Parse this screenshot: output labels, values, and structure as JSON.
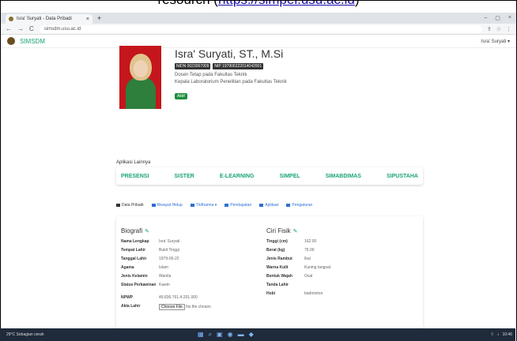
{
  "caption": {
    "before": "resourch (",
    "link": "https://simpel.usu.ac.id",
    "after": ")"
  },
  "browser": {
    "tab_title": "Isra' Suryati - Data Pribadi",
    "tab_close": "×",
    "new_tab": "+",
    "url": "simsdm.usu.ac.id",
    "controls": {
      "minimize": "–",
      "maximize": "▢",
      "close": "×"
    }
  },
  "app": {
    "brand": "SIMSDM",
    "user": "Isra' Suryati ▾"
  },
  "profile": {
    "name": "Isra' Suryati, ST., M.Si",
    "nidn": "NIDN 0023067909",
    "nip": "NIP 197906222014042001",
    "role": "Dosen Tetap pada Fakultas Teknik",
    "position": "Kepala Laboratorium Penelitian pada Fakultas Teknik",
    "status": "Aktif"
  },
  "apps": {
    "title": "Aplikasi Lainnya",
    "items": [
      "PRESENSI",
      "SISTER",
      "E-LEARNING",
      "SIMPEL",
      "SIMABDIMAS",
      "SIPUSTAHA"
    ]
  },
  "tabs": [
    "Data Pribadi",
    "Riwayat Hidup",
    "Tridharma ▾",
    "Pendapatan",
    "Aplikasi",
    "Pengaturan"
  ],
  "biografi": {
    "title": "Biografi",
    "rows": [
      {
        "k": "Nama Lengkap",
        "v": "Isra' Suryati"
      },
      {
        "k": "Tempat Lahir",
        "v": "Bukit Tinggi"
      },
      {
        "k": "Tanggal Lahir",
        "v": "1979-06-22"
      },
      {
        "k": "Agama",
        "v": "Islam"
      },
      {
        "k": "Jenis Kelamin",
        "v": "Wanita"
      },
      {
        "k": "Status Perkawinan",
        "v": "Kawin"
      },
      {
        "k": "NPWP",
        "v": "49.836.761.4-201.000"
      },
      {
        "k": "Akta Lahir",
        "v": "No file chosen"
      }
    ],
    "file_button": "Choose File"
  },
  "ciri_fisik": {
    "title": "Ciri Fisik",
    "rows": [
      {
        "k": "Tinggi (cm)",
        "v": "162.00"
      },
      {
        "k": "Berat (kg)",
        "v": "75.00"
      },
      {
        "k": "Jenis Rambut",
        "v": "Ikal"
      },
      {
        "k": "Warna Kulit",
        "v": "Kuning langsat"
      },
      {
        "k": "Bentuk Wajah",
        "v": "Oval"
      },
      {
        "k": "Tanda Lahir",
        "v": ""
      },
      {
        "k": "Hobi",
        "v": "badminton"
      }
    ]
  },
  "taskbar": {
    "weather": "29°C Sebagian cerah",
    "time": "10:46"
  },
  "colors": {
    "accent": "#1aa37a",
    "badge": "#333333",
    "status": "#1e8e3e"
  }
}
